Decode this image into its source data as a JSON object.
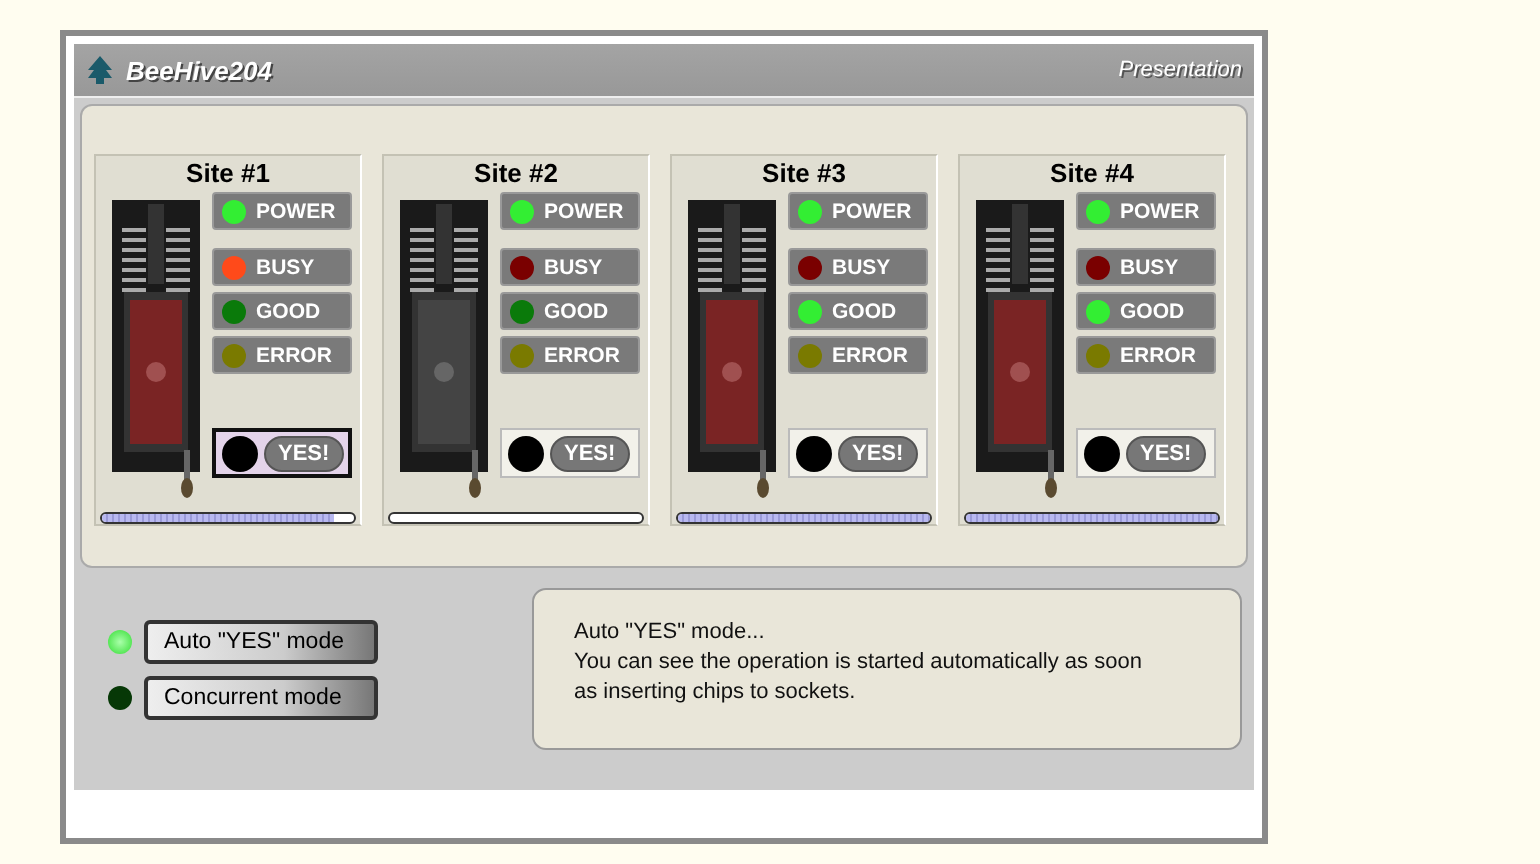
{
  "header": {
    "title": "BeeHive204",
    "mode_label": "Presentation"
  },
  "sites": [
    {
      "title": "Site #1",
      "chip_inserted": true,
      "leds": [
        {
          "label": "POWER",
          "kind": "power",
          "on": true
        },
        {
          "label": "BUSY",
          "kind": "busy",
          "on": true
        },
        {
          "label": "GOOD",
          "kind": "good",
          "on": false
        },
        {
          "label": "ERROR",
          "kind": "error",
          "on": false
        }
      ],
      "yes_label": "YES!",
      "selected": true,
      "level": 0.92
    },
    {
      "title": "Site #2",
      "chip_inserted": false,
      "leds": [
        {
          "label": "POWER",
          "kind": "power",
          "on": true
        },
        {
          "label": "BUSY",
          "kind": "busy",
          "on": false
        },
        {
          "label": "GOOD",
          "kind": "good",
          "on": false
        },
        {
          "label": "ERROR",
          "kind": "error",
          "on": false
        }
      ],
      "yes_label": "YES!",
      "selected": false,
      "level": 0
    },
    {
      "title": "Site #3",
      "chip_inserted": true,
      "leds": [
        {
          "label": "POWER",
          "kind": "power",
          "on": true
        },
        {
          "label": "BUSY",
          "kind": "busy",
          "on": false
        },
        {
          "label": "GOOD",
          "kind": "good",
          "on": true
        },
        {
          "label": "ERROR",
          "kind": "error",
          "on": false
        }
      ],
      "yes_label": "YES!",
      "selected": false,
      "level": 1
    },
    {
      "title": "Site #4",
      "chip_inserted": true,
      "leds": [
        {
          "label": "POWER",
          "kind": "power",
          "on": true
        },
        {
          "label": "BUSY",
          "kind": "busy",
          "on": false
        },
        {
          "label": "GOOD",
          "kind": "good",
          "on": true
        },
        {
          "label": "ERROR",
          "kind": "error",
          "on": false
        }
      ],
      "yes_label": "YES!",
      "selected": false,
      "level": 1
    }
  ],
  "modes": [
    {
      "label": "Auto \"YES\" mode",
      "on": true
    },
    {
      "label": "Concurrent mode",
      "on": false
    }
  ],
  "description": {
    "title": "Auto \"YES\" mode...",
    "body": "You can see the operation is started automatically as soon as inserting chips to sockets."
  }
}
